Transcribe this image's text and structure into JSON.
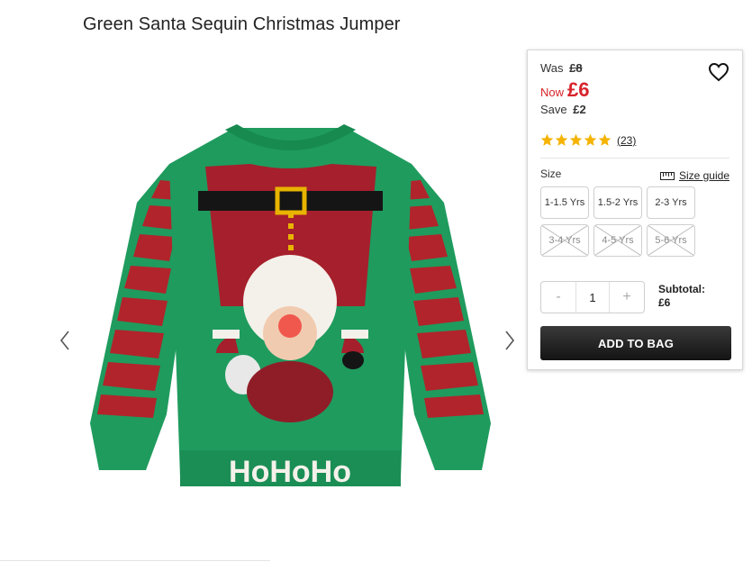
{
  "product": {
    "title": "Green Santa Sequin Christmas Jumper",
    "image_alt": "Green Santa Sequin Christmas Jumper",
    "image_text": "HoHoHo"
  },
  "gallery": {
    "prev_icon": "chevron-left-icon",
    "next_icon": "chevron-right-icon"
  },
  "price": {
    "was_label": "Was",
    "was_value": "£8",
    "now_label": "Now",
    "now_value": "£6",
    "save_label": "Save",
    "save_value": "£2",
    "accent_color": "#d8232a"
  },
  "wishlist": {
    "icon": "heart-icon"
  },
  "rating": {
    "stars": 5,
    "max_stars": 5,
    "review_count": "(23)",
    "star_color": "#f5b301"
  },
  "size": {
    "label": "Size",
    "guide_label": "Size guide",
    "guide_icon": "ruler-icon",
    "options": [
      {
        "label": "1-1.5 Yrs",
        "available": true
      },
      {
        "label": "1.5-2 Yrs",
        "available": true
      },
      {
        "label": "2-3 Yrs",
        "available": true
      },
      {
        "label": "3-4 Yrs",
        "available": false
      },
      {
        "label": "4-5 Yrs",
        "available": false
      },
      {
        "label": "5-6 Yrs",
        "available": false
      }
    ]
  },
  "quantity": {
    "minus": "-",
    "value": "1",
    "plus": "+"
  },
  "subtotal": {
    "label": "Subtotal:",
    "value": "£6"
  },
  "cta": {
    "add_to_bag": "ADD TO BAG"
  }
}
